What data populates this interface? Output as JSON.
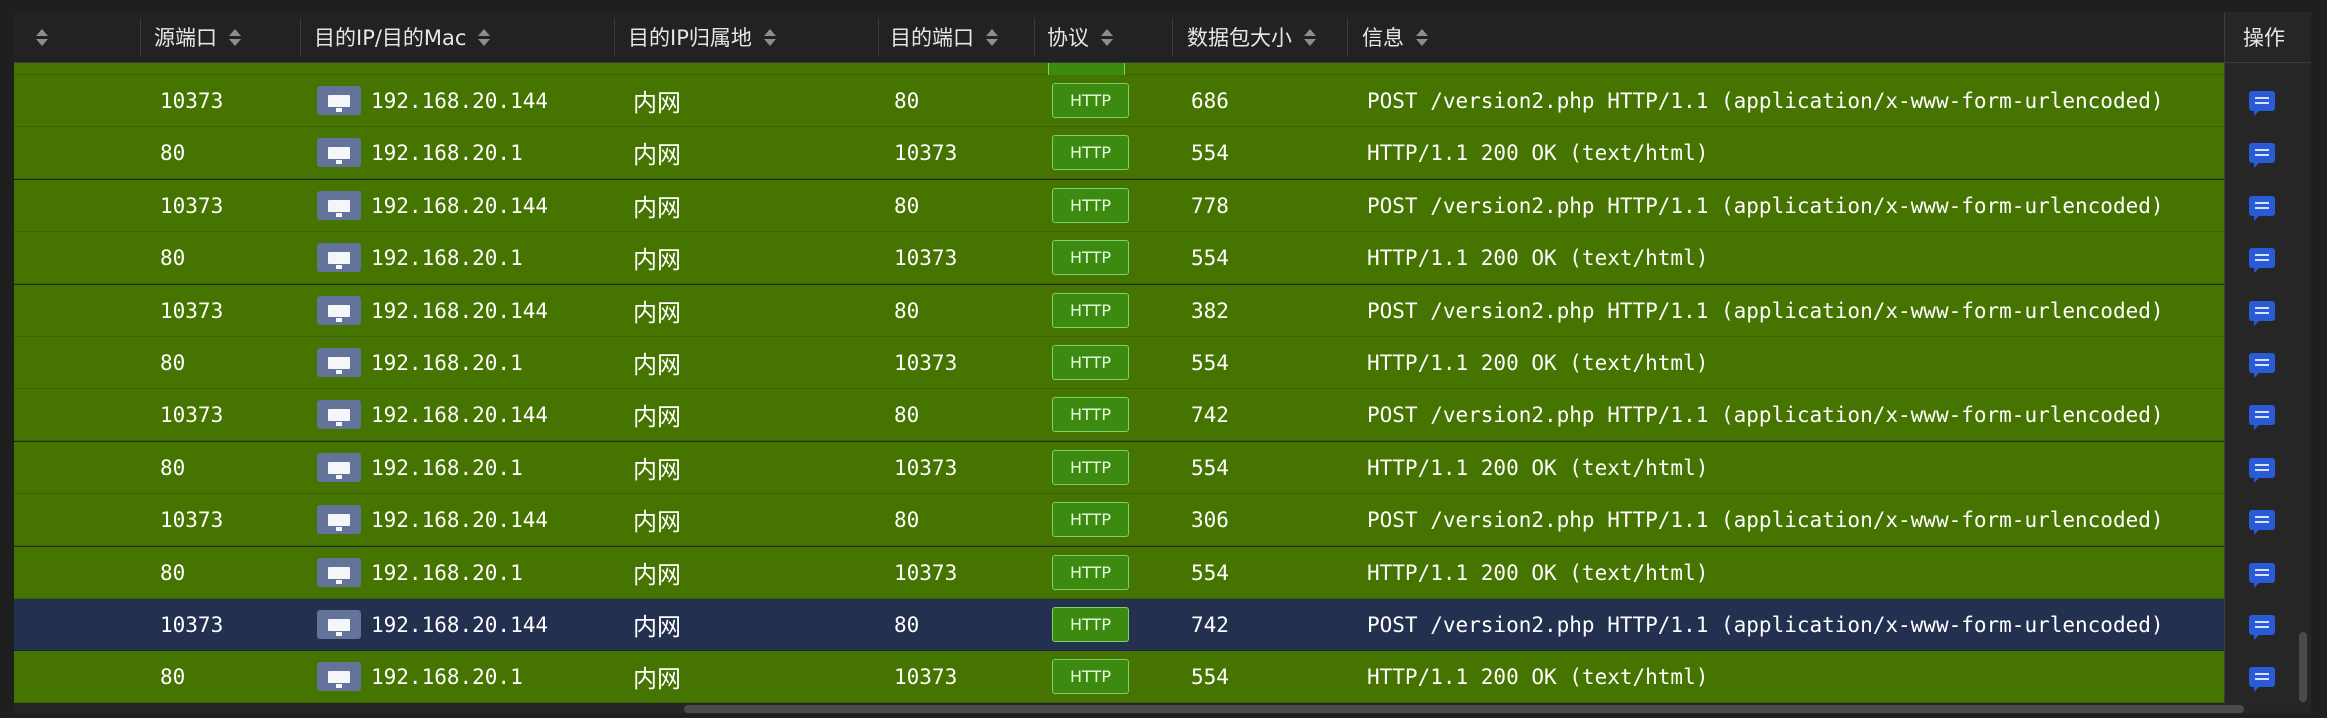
{
  "columns": {
    "src_port": "源端口",
    "dst_ip": "目的IP/目的Mac",
    "dst_location": "目的IP归属地",
    "dst_port": "目的端口",
    "protocol": "协议",
    "size": "数据包大小",
    "info": "信息",
    "operation": "操作"
  },
  "rows": [
    {
      "src_port": "10373",
      "dst_ip": "192.168.20.144",
      "location": "内网",
      "dst_port": "80",
      "protocol": "HTTP",
      "size": "686",
      "info": "POST /version2.php HTTP/1.1 (application/x-www-form-urlencoded)",
      "selected": false
    },
    {
      "src_port": "80",
      "dst_ip": "192.168.20.1",
      "location": "内网",
      "dst_port": "10373",
      "protocol": "HTTP",
      "size": "554",
      "info": "HTTP/1.1 200 OK (text/html)",
      "selected": false
    },
    {
      "src_port": "10373",
      "dst_ip": "192.168.20.144",
      "location": "内网",
      "dst_port": "80",
      "protocol": "HTTP",
      "size": "778",
      "info": "POST /version2.php HTTP/1.1 (application/x-www-form-urlencoded)",
      "selected": false
    },
    {
      "src_port": "80",
      "dst_ip": "192.168.20.1",
      "location": "内网",
      "dst_port": "10373",
      "protocol": "HTTP",
      "size": "554",
      "info": "HTTP/1.1 200 OK (text/html)",
      "selected": false
    },
    {
      "src_port": "10373",
      "dst_ip": "192.168.20.144",
      "location": "内网",
      "dst_port": "80",
      "protocol": "HTTP",
      "size": "382",
      "info": "POST /version2.php HTTP/1.1 (application/x-www-form-urlencoded)",
      "selected": false
    },
    {
      "src_port": "80",
      "dst_ip": "192.168.20.1",
      "location": "内网",
      "dst_port": "10373",
      "protocol": "HTTP",
      "size": "554",
      "info": "HTTP/1.1 200 OK (text/html)",
      "selected": false
    },
    {
      "src_port": "10373",
      "dst_ip": "192.168.20.144",
      "location": "内网",
      "dst_port": "80",
      "protocol": "HTTP",
      "size": "742",
      "info": "POST /version2.php HTTP/1.1 (application/x-www-form-urlencoded)",
      "selected": false
    },
    {
      "src_port": "80",
      "dst_ip": "192.168.20.1",
      "location": "内网",
      "dst_port": "10373",
      "protocol": "HTTP",
      "size": "554",
      "info": "HTTP/1.1 200 OK (text/html)",
      "selected": false
    },
    {
      "src_port": "10373",
      "dst_ip": "192.168.20.144",
      "location": "内网",
      "dst_port": "80",
      "protocol": "HTTP",
      "size": "306",
      "info": "POST /version2.php HTTP/1.1 (application/x-www-form-urlencoded)",
      "selected": false
    },
    {
      "src_port": "80",
      "dst_ip": "192.168.20.1",
      "location": "内网",
      "dst_port": "10373",
      "protocol": "HTTP",
      "size": "554",
      "info": "HTTP/1.1 200 OK (text/html)",
      "selected": false
    },
    {
      "src_port": "10373",
      "dst_ip": "192.168.20.144",
      "location": "内网",
      "dst_port": "80",
      "protocol": "HTTP",
      "size": "742",
      "info": "POST /version2.php HTTP/1.1 (application/x-www-form-urlencoded)",
      "selected": true
    },
    {
      "src_port": "80",
      "dst_ip": "192.168.20.1",
      "location": "内网",
      "dst_port": "10373",
      "protocol": "HTTP",
      "size": "554",
      "info": "HTTP/1.1 200 OK (text/html)",
      "selected": false
    }
  ],
  "icons": {
    "host": "computer-monitor-icon",
    "detail": "message-detail-icon",
    "sort": "sort-caret-icon"
  },
  "colors": {
    "row_bg": "#457400",
    "selected_bg": "#233050",
    "protocol_badge": "#3d8a10",
    "action_button": "#2a5bd7"
  }
}
